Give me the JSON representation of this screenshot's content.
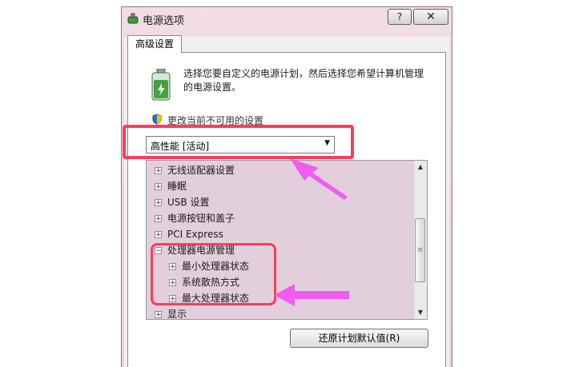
{
  "window": {
    "title": "电源选项",
    "help_label": "?",
    "close_label": "✕"
  },
  "tab": {
    "label": "高级设置"
  },
  "description": "选择您要自定义的电源计划，然后选择您希望计算机管理的电源设置。",
  "change_settings_link": "更改当前不可用的设置",
  "plan_dropdown": {
    "selected": "高性能 [活动]",
    "arrow": "▼"
  },
  "tree": {
    "items": [
      {
        "label": "无线适配器设置",
        "expander": "+"
      },
      {
        "label": "睡眠",
        "expander": "+"
      },
      {
        "label": "USB 设置",
        "expander": "+"
      },
      {
        "label": "电源按钮和盖子",
        "expander": "+"
      },
      {
        "label": "PCI Express",
        "expander": "+"
      },
      {
        "label": "处理器电源管理",
        "expander": "−"
      },
      {
        "label": "最小处理器状态",
        "expander": "+"
      },
      {
        "label": "系统散热方式",
        "expander": "+"
      },
      {
        "label": "最大处理器状态",
        "expander": "+"
      },
      {
        "label": "显示",
        "expander": "+"
      }
    ],
    "scroll_up": "▲",
    "scroll_down": "▼",
    "thumb_grip": "≡"
  },
  "restore_button": "还原计划默认值(R)",
  "colors": {
    "annotation": "#ff3b5c",
    "arrow": "#f05cf0",
    "tree_background": "#e3cfdc"
  }
}
